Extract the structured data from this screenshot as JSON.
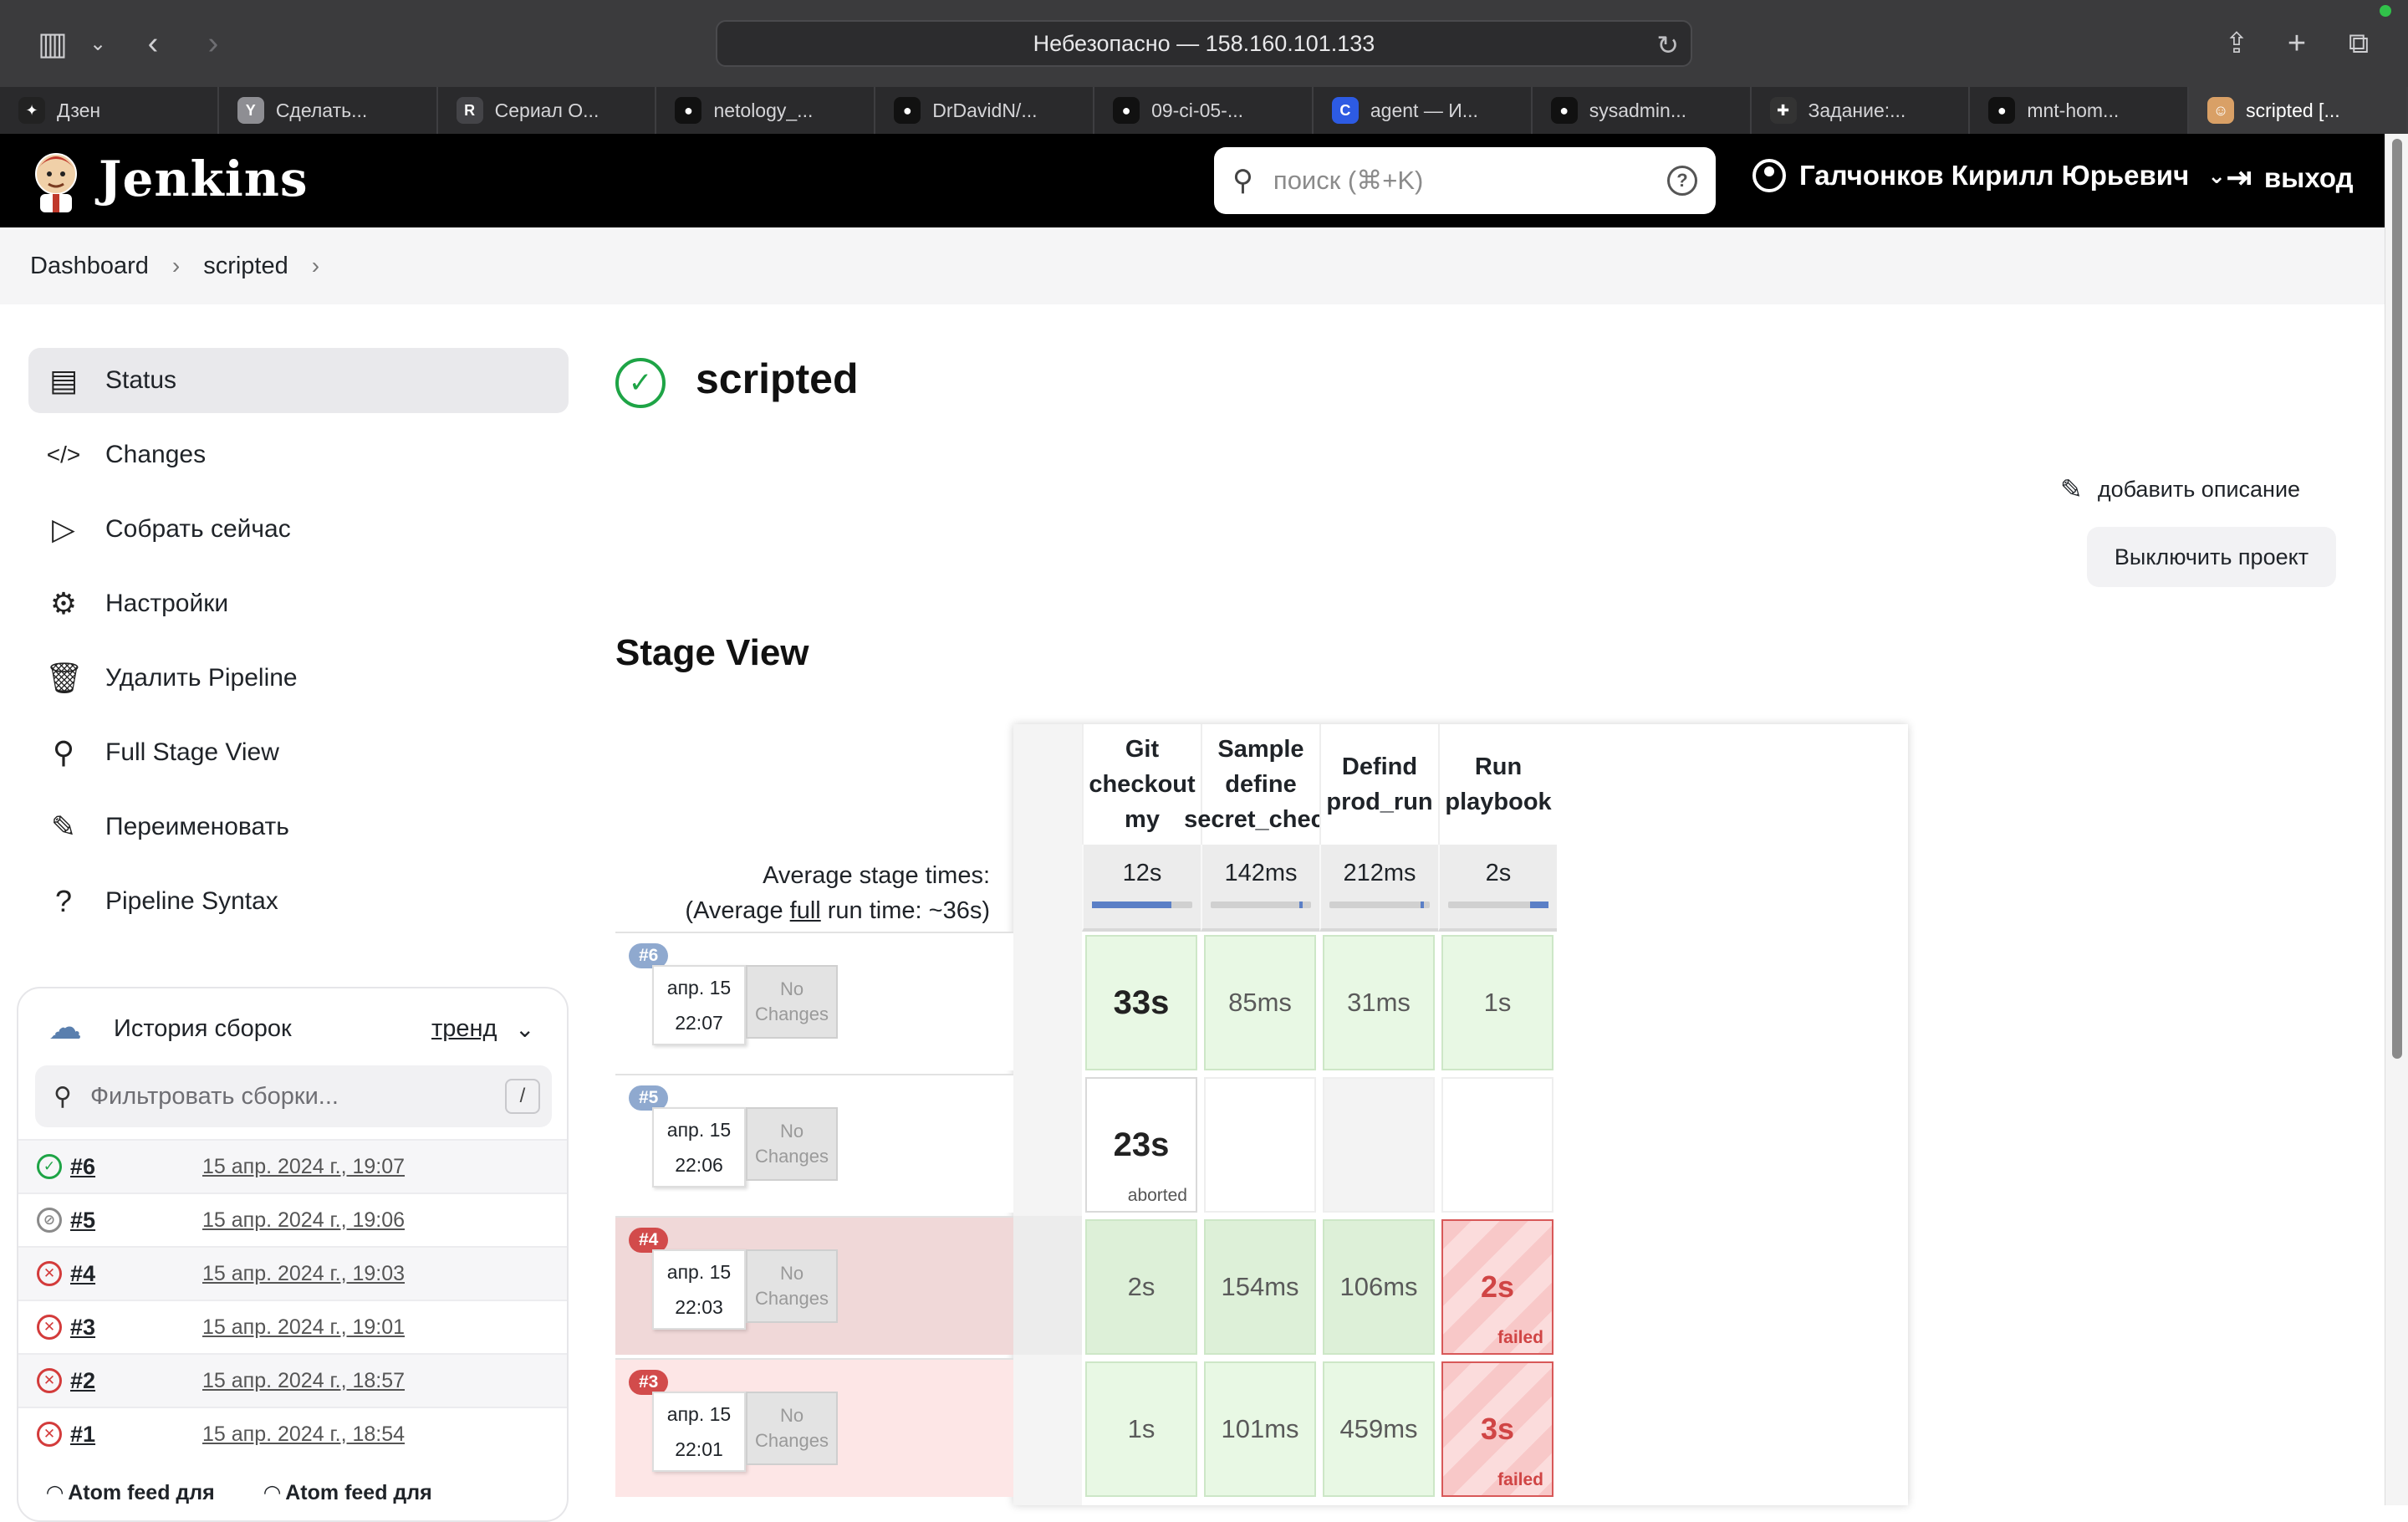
{
  "browser": {
    "address": "Небезопасно — 158.160.101.133",
    "tabs": [
      {
        "label": "Дзен",
        "icon": "dzen-icon",
        "color": "#222222",
        "glyph": "✦"
      },
      {
        "label": "Сделать...",
        "icon": "yandex-icon",
        "color": "#8e8e93",
        "glyph": "Y"
      },
      {
        "label": "Сериал О...",
        "icon": "r-icon",
        "color": "#444448",
        "glyph": "R"
      },
      {
        "label": "netology_...",
        "icon": "github-icon",
        "color": "#111111",
        "glyph": "●"
      },
      {
        "label": "DrDavidN/...",
        "icon": "github-icon",
        "color": "#111111",
        "glyph": "●"
      },
      {
        "label": "09-ci-05-...",
        "icon": "github-icon",
        "color": "#111111",
        "glyph": "●"
      },
      {
        "label": "agent — И...",
        "icon": "c-icon",
        "color": "#2d5be3",
        "glyph": "C"
      },
      {
        "label": "sysadmin...",
        "icon": "github-icon",
        "color": "#111111",
        "glyph": "●"
      },
      {
        "label": "Задание:...",
        "icon": "task-icon",
        "color": "#333333",
        "glyph": "✚"
      },
      {
        "label": "mnt-hom...",
        "icon": "github-icon",
        "color": "#111111",
        "glyph": "●"
      },
      {
        "label": "scripted [...",
        "icon": "jenkins-icon",
        "color": "#d9a066",
        "glyph": "☺"
      }
    ]
  },
  "header": {
    "title": "Jenkins",
    "search_placeholder": "поиск (⌘+K)",
    "user": "Галчонков Кирилл Юрьевич",
    "logout": "выход"
  },
  "breadcrumb": [
    "Dashboard",
    "scripted"
  ],
  "sidebar": {
    "items": [
      {
        "label": "Status",
        "icon": "status-icon",
        "glyph": "▤"
      },
      {
        "label": "Changes",
        "icon": "code-icon",
        "glyph": "</>"
      },
      {
        "label": "Собрать сейчас",
        "icon": "play-icon",
        "glyph": "▷"
      },
      {
        "label": "Настройки",
        "icon": "gear-icon",
        "glyph": "⚙"
      },
      {
        "label": "Удалить Pipeline",
        "icon": "trash-icon",
        "glyph": "🗑"
      },
      {
        "label": "Full Stage View",
        "icon": "search-icon",
        "glyph": "⚲"
      },
      {
        "label": "Переименовать",
        "icon": "pencil-icon",
        "glyph": "✎"
      },
      {
        "label": "Pipeline Syntax",
        "icon": "help-icon",
        "glyph": "?"
      }
    ]
  },
  "history": {
    "title": "История сборок",
    "trend": "тренд",
    "filter_placeholder": "Фильтровать сборки...",
    "filter_shortcut": "/",
    "builds": [
      {
        "num": "#6",
        "date": "15 апр. 2024 г., 19:07",
        "status": "success"
      },
      {
        "num": "#5",
        "date": "15 апр. 2024 г., 19:06",
        "status": "aborted"
      },
      {
        "num": "#4",
        "date": "15 апр. 2024 г., 19:03",
        "status": "failed"
      },
      {
        "num": "#3",
        "date": "15 апр. 2024 г., 19:01",
        "status": "failed"
      },
      {
        "num": "#2",
        "date": "15 апр. 2024 г., 18:57",
        "status": "failed"
      },
      {
        "num": "#1",
        "date": "15 апр. 2024 г., 18:54",
        "status": "failed"
      }
    ],
    "atom_all": "Atom feed для",
    "atom_failed": "Atom feed для"
  },
  "job": {
    "title": "scripted",
    "add_description": "добавить описание",
    "disable": "Выключить проект"
  },
  "stage_view": {
    "title": "Stage View",
    "avg_line1": "Average stage times:",
    "avg_line2_prefix": "(Average ",
    "avg_line2_full": "full",
    "avg_line2_suffix": " run time: ~36s)",
    "stages": [
      {
        "name": "Git checkout my",
        "avg": "12s",
        "avg_fraction": 0.79
      },
      {
        "name": "Sample define secret_check",
        "avg": "142ms",
        "avg_fraction": 0.02
      },
      {
        "name": "Defind prod_run",
        "avg": "212ms",
        "avg_fraction": 0.02
      },
      {
        "name": "Run playbook",
        "avg": "2s",
        "avg_fraction": 0.18
      }
    ],
    "runs": [
      {
        "badge": "#6",
        "date": "апр. 15",
        "time": "22:07",
        "changes": "No Changes",
        "status": "success",
        "cells": [
          {
            "t": "33s",
            "s": "ok",
            "big": true
          },
          {
            "t": "85ms",
            "s": "ok"
          },
          {
            "t": "31ms",
            "s": "ok"
          },
          {
            "t": "1s",
            "s": "ok"
          }
        ]
      },
      {
        "badge": "#5",
        "date": "апр. 15",
        "time": "22:06",
        "changes": "No Changes",
        "status": "aborted",
        "cells": [
          {
            "t": "23s",
            "s": "aborted",
            "big": true,
            "note": "aborted"
          },
          {
            "t": "",
            "s": "empty"
          },
          {
            "t": "",
            "s": "empty-grey"
          },
          {
            "t": "",
            "s": "empty"
          }
        ]
      },
      {
        "badge": "#4",
        "date": "апр. 15",
        "time": "22:03",
        "changes": "No Changes",
        "status": "failed",
        "cells": [
          {
            "t": "2s",
            "s": "ok"
          },
          {
            "t": "154ms",
            "s": "ok"
          },
          {
            "t": "106ms",
            "s": "ok"
          },
          {
            "t": "2s",
            "s": "fail",
            "note": "failed"
          }
        ]
      },
      {
        "badge": "#3",
        "date": "апр. 15",
        "time": "22:01",
        "changes": "No Changes",
        "status": "failed",
        "cells": [
          {
            "t": "1s",
            "s": "ok"
          },
          {
            "t": "101ms",
            "s": "ok"
          },
          {
            "t": "459ms",
            "s": "ok"
          },
          {
            "t": "3s",
            "s": "fail",
            "note": "failed"
          }
        ]
      }
    ]
  },
  "colors": {
    "success": "#1ea446",
    "failed": "#d33b3b",
    "aborted": "#8a8a8a",
    "badge_ok": "#8fa9cf",
    "badge_fail": "#d24b4b",
    "accent_bar": "#5b7fc6"
  }
}
